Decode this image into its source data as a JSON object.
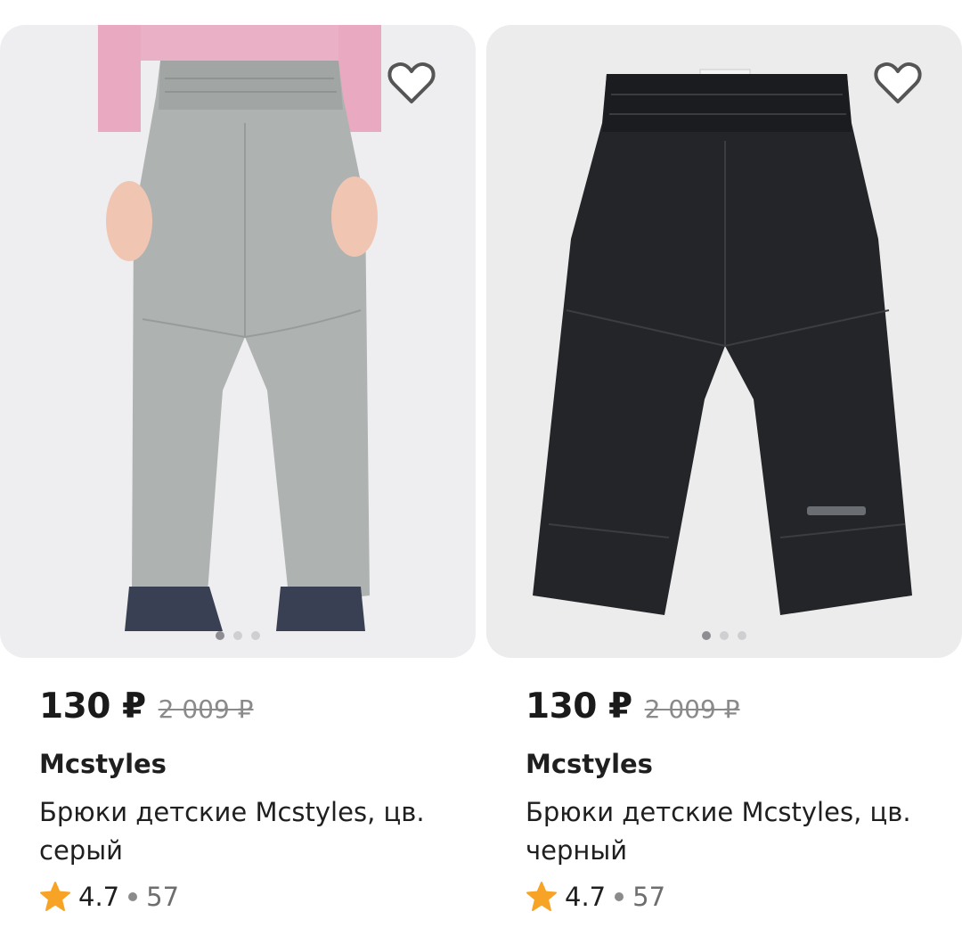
{
  "products": [
    {
      "price": "130 ₽",
      "old_price": "2 009 ₽",
      "brand": "Mcstyles",
      "title": "Брюки детские Mcstyles, цв. серый",
      "rating": "4.7",
      "reviews": "57",
      "image_icon": "gray-kids-pants-photo",
      "favorite_icon": "heart-outline-icon",
      "gallery": {
        "count": 3,
        "active": 1
      }
    },
    {
      "price": "130 ₽",
      "old_price": "2 009 ₽",
      "brand": "Mcstyles",
      "title": "Брюки детские Mcstyles, цв. черный",
      "rating": "4.7",
      "reviews": "57",
      "image_icon": "black-kids-pants-photo",
      "favorite_icon": "heart-outline-icon",
      "gallery": {
        "count": 3,
        "active": 1
      }
    }
  ],
  "colors": {
    "star": "#f7a325",
    "text": "#1f1f1f",
    "old_price": "#8a8a8a"
  }
}
